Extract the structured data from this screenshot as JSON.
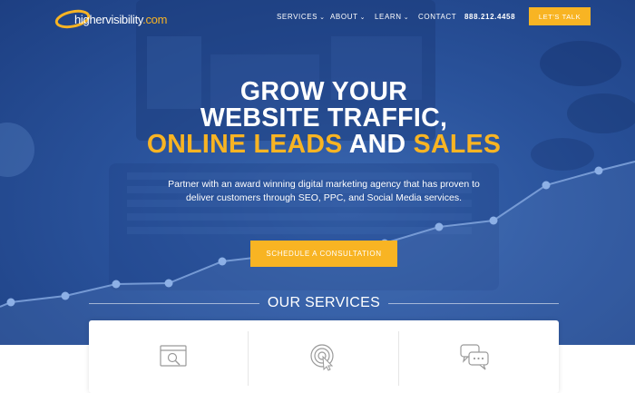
{
  "brand": {
    "logo_main": "highervisibility",
    "logo_suffix": ".com",
    "accent_color": "#f8b423",
    "hero_color": "#2a539c"
  },
  "nav": {
    "items": [
      {
        "label": "SERVICES",
        "icon": "chevron-down-icon"
      },
      {
        "label": "ABOUT",
        "icon": "chevron-down-icon"
      },
      {
        "label": "LEARN",
        "icon": "chevron-down-icon"
      },
      {
        "label": "CONTACT"
      }
    ],
    "phone": "888.212.4458",
    "cta": "LET'S TALK"
  },
  "hero": {
    "headline_line1": "GROW YOUR",
    "headline_line2": "WEBSITE TRAFFIC,",
    "headline_highlight1": "ONLINE LEADS",
    "headline_and": "AND",
    "headline_highlight2": "SALES",
    "subtext_line1": "Partner with an award winning digital marketing agency that has proven to",
    "subtext_line2": "deliver customers through SEO, PPC, and Social Media services.",
    "cta": "SCHEDULE A CONSULTATION"
  },
  "services": {
    "title": "OUR SERVICES",
    "cards": [
      {
        "icon": "search-window-icon"
      },
      {
        "icon": "target-cursor-icon"
      },
      {
        "icon": "chat-bubbles-icon"
      }
    ]
  }
}
